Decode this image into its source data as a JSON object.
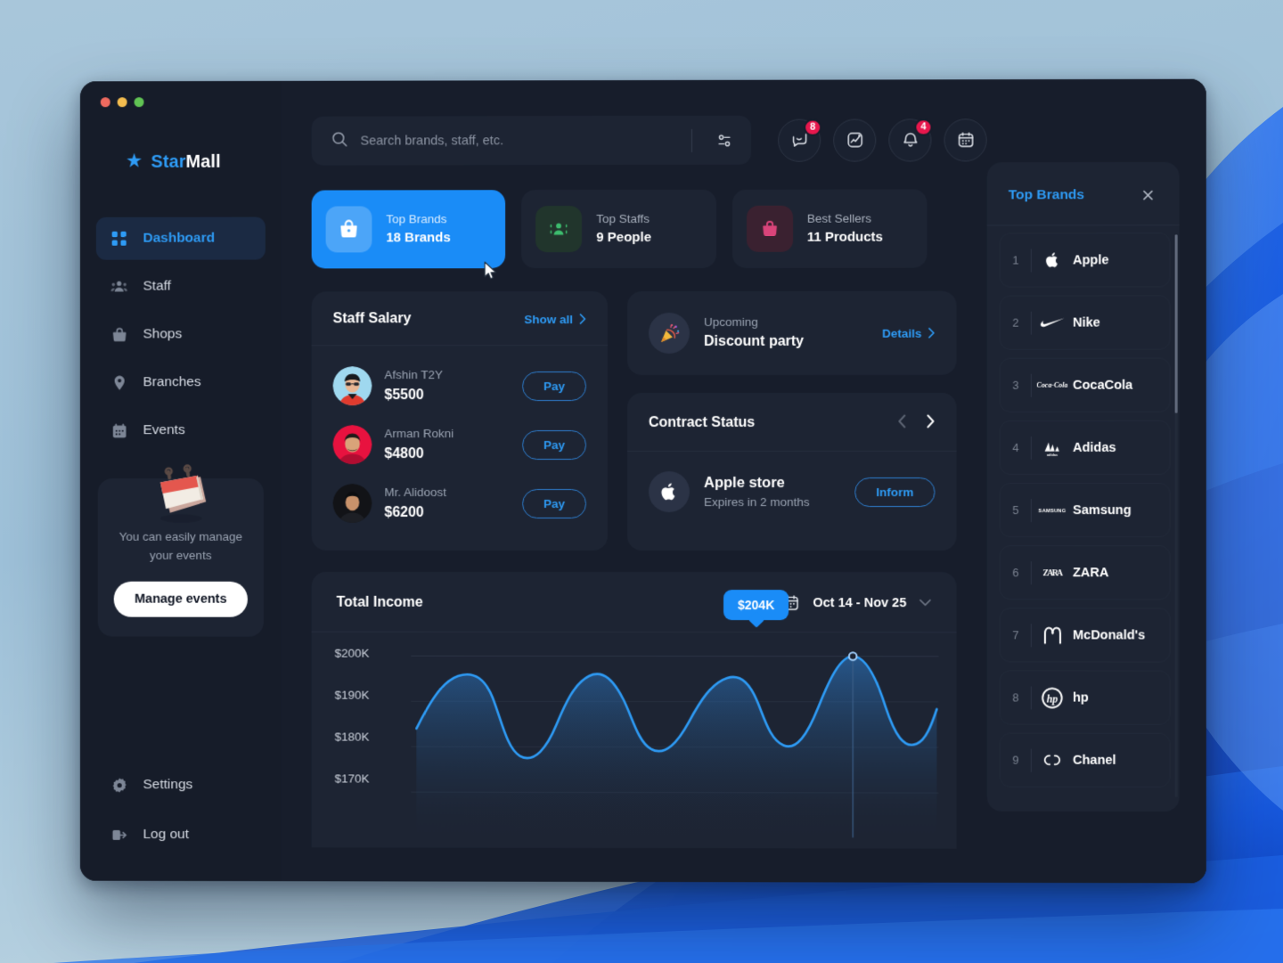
{
  "window": {
    "traffic_lights": [
      "close",
      "minimize",
      "maximize"
    ]
  },
  "sidebar": {
    "brand": {
      "part1": "Star",
      "part2": "Mall",
      "icon": "star-icon"
    },
    "items": [
      {
        "label": "Dashboard",
        "icon": "grid-icon",
        "active": true
      },
      {
        "label": "Staff",
        "icon": "people-icon",
        "active": false
      },
      {
        "label": "Shops",
        "icon": "bag-icon",
        "active": false
      },
      {
        "label": "Branches",
        "icon": "location-pin-icon",
        "active": false
      },
      {
        "label": "Events",
        "icon": "calendar-icon",
        "active": false
      }
    ],
    "events_card": {
      "illustration": "calendar-3d-illustration",
      "text": "You can easily manage your events",
      "button_label": "Manage events"
    },
    "bottom_items": [
      {
        "label": "Settings",
        "icon": "gear-icon"
      },
      {
        "label": "Log out",
        "icon": "logout-icon"
      }
    ]
  },
  "topbar": {
    "search": {
      "placeholder": "Search brands, staff, etc.",
      "value": "",
      "icon": "search-icon",
      "filter_icon": "sliders-icon"
    },
    "icon_buttons": [
      {
        "name": "messages-icon",
        "badge": "8"
      },
      {
        "name": "analytics-icon",
        "badge": ""
      },
      {
        "name": "bell-icon",
        "badge": "4"
      },
      {
        "name": "calendar-icon",
        "badge": ""
      }
    ]
  },
  "stats": [
    {
      "label": "Top Brands",
      "value": "18 Brands",
      "icon": "shopping-bag-icon",
      "active": true,
      "accent": "#1a8cf7"
    },
    {
      "label": "Top Staffs",
      "value": "9 People",
      "icon": "staff-group-icon",
      "active": false,
      "accent": "#3dbd6e"
    },
    {
      "label": "Best Sellers",
      "value": "11 Products",
      "icon": "handbag-icon",
      "active": false,
      "accent": "#d9447a"
    }
  ],
  "staff_salary": {
    "title": "Staff Salary",
    "show_all_label": "Show all",
    "rows": [
      {
        "name": "Afshin T2Y",
        "amount": "$5500",
        "action": "Pay",
        "avatar_bg": "#9fd8ef"
      },
      {
        "name": "Arman Rokni",
        "amount": "$4800",
        "action": "Pay",
        "avatar_bg": "#e8123f"
      },
      {
        "name": "Mr. Alidoost",
        "amount": "$6200",
        "action": "Pay",
        "avatar_bg": "#15161a"
      }
    ]
  },
  "upcoming": {
    "label": "Upcoming",
    "title": "Discount party",
    "details_label": "Details",
    "icon": "party-popper-icon"
  },
  "contract_status": {
    "title": "Contract Status",
    "prev_icon": "chevron-left-icon",
    "next_icon": "chevron-right-icon",
    "item": {
      "name": "Apple store",
      "subtitle": "Expires in 2 months",
      "action": "Inform",
      "logo": "apple-logo-icon"
    }
  },
  "chart_data": {
    "type": "area",
    "title": "Total Income",
    "date_range": "Oct 14 - Nov 25",
    "calendar_icon": "calendar-icon",
    "chevron_icon": "chevron-down-icon",
    "ylabel": "",
    "xlabel": "",
    "ytick_labels": [
      "$200K",
      "$190K",
      "$180K",
      "$170K"
    ],
    "yticks": [
      200,
      190,
      180,
      170
    ],
    "ylim": [
      165,
      208
    ],
    "grid": true,
    "legend": null,
    "line_color": "#2e9bf5",
    "fill_top": "#27527f",
    "fill_bottom": "#1d2433",
    "tooltip": {
      "label": "$204K",
      "value": 204,
      "x_index": 16
    },
    "x": [
      0,
      1,
      2,
      3,
      4,
      5,
      6,
      7,
      8,
      9,
      10,
      11,
      12,
      13,
      14,
      15,
      16,
      17,
      18,
      19,
      20
    ],
    "values": [
      184,
      191,
      195,
      188,
      180,
      183,
      192,
      196,
      190,
      184,
      185,
      192,
      198,
      193,
      189,
      192,
      204,
      199,
      190,
      189,
      196
    ]
  },
  "top_brands": {
    "title": "Top Brands",
    "close_icon": "close-icon",
    "rows": [
      {
        "rank": "1",
        "name": "Apple",
        "logo": "apple-logo-icon"
      },
      {
        "rank": "2",
        "name": "Nike",
        "logo": "nike-swoosh-icon"
      },
      {
        "rank": "3",
        "name": "CocaCola",
        "logo": "cocacola-logo-icon"
      },
      {
        "rank": "4",
        "name": "Adidas",
        "logo": "adidas-logo-icon"
      },
      {
        "rank": "5",
        "name": "Samsung",
        "logo": "samsung-logo-icon"
      },
      {
        "rank": "6",
        "name": "ZARA",
        "logo": "zara-logo-icon"
      },
      {
        "rank": "7",
        "name": "McDonald's",
        "logo": "mcdonalds-logo-icon"
      },
      {
        "rank": "8",
        "name": "hp",
        "logo": "hp-logo-icon"
      },
      {
        "rank": "9",
        "name": "Chanel",
        "logo": "chanel-logo-icon"
      }
    ]
  }
}
